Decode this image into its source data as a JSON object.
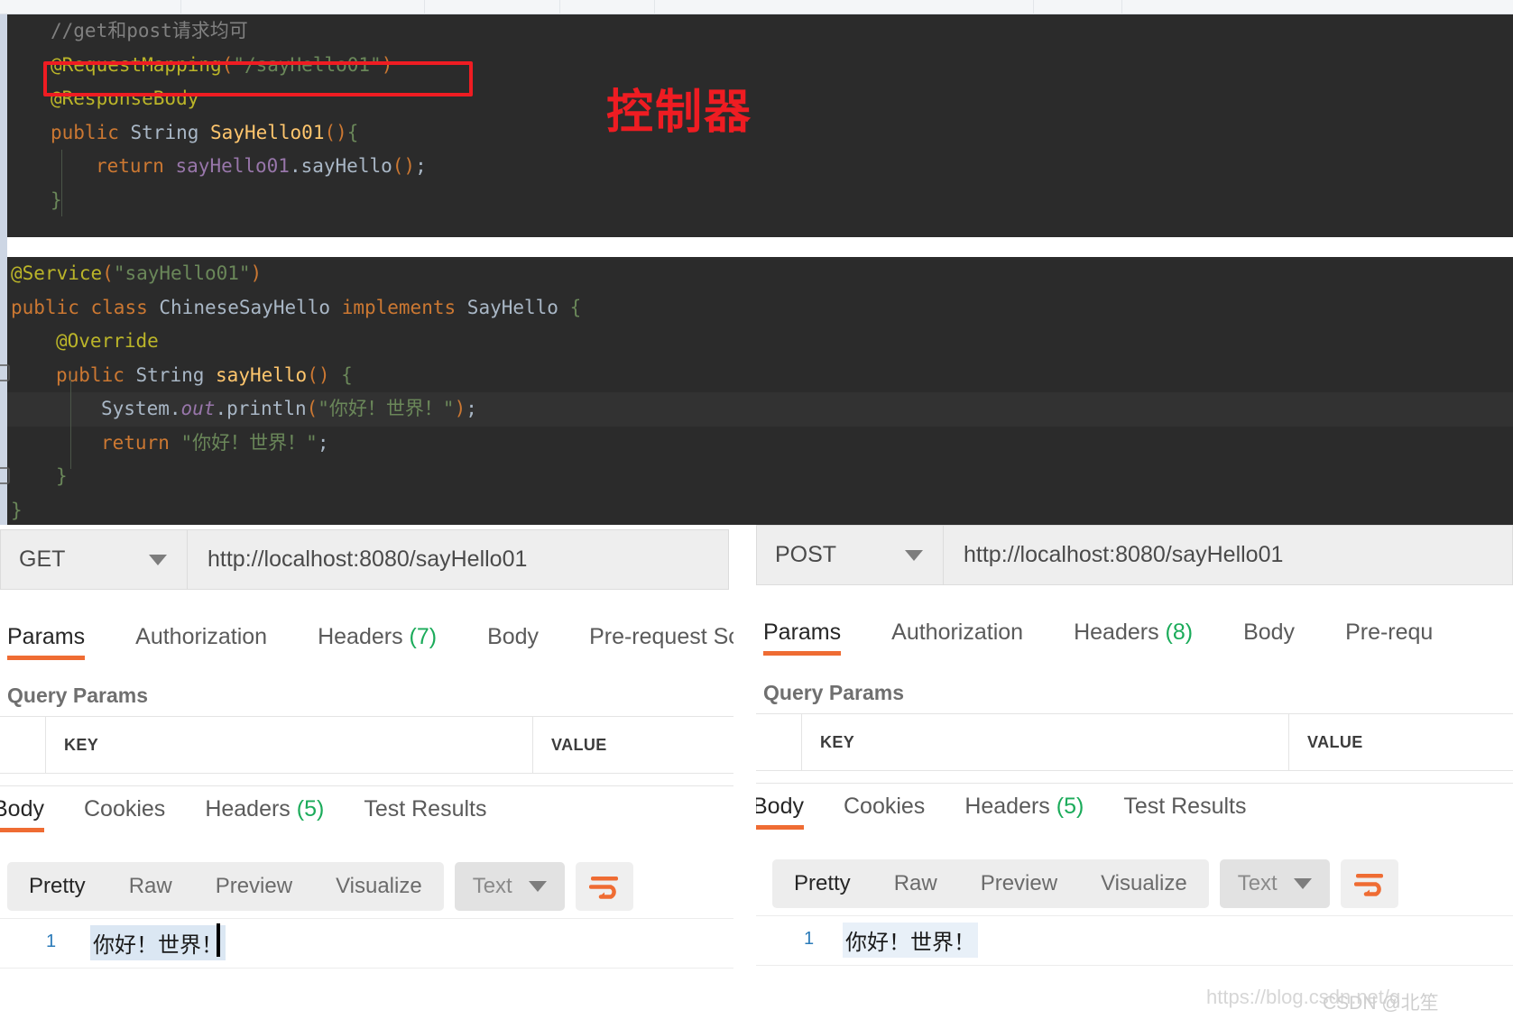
{
  "code_controller": {
    "lines": [
      {
        "indent": 0,
        "tokens": [
          {
            "t": "//get和post请求均可",
            "c": "t-comment"
          }
        ]
      },
      {
        "indent": 0,
        "tokens": [
          {
            "t": "@RequestMapping",
            "c": "t-anno"
          },
          {
            "t": "(",
            "c": "t-paren"
          },
          {
            "t": "\"/sayHello01\"",
            "c": "t-string"
          },
          {
            "t": ")",
            "c": "t-paren"
          }
        ]
      },
      {
        "indent": 0,
        "tokens": [
          {
            "t": "@ResponseBody",
            "c": "t-anno"
          }
        ]
      },
      {
        "indent": 0,
        "tokens": [
          {
            "t": "public",
            "c": "t-kw"
          },
          {
            "t": " ",
            "c": "t-ident"
          },
          {
            "t": "String",
            "c": "t-type"
          },
          {
            "t": " ",
            "c": "t-ident"
          },
          {
            "t": "SayHello01",
            "c": "t-method"
          },
          {
            "t": "()",
            "c": "t-paren"
          },
          {
            "t": "{",
            "c": "t-brace"
          }
        ]
      },
      {
        "indent": 1,
        "tokens": [
          {
            "t": "return",
            "c": "t-kw"
          },
          {
            "t": " ",
            "c": "t-ident"
          },
          {
            "t": "sayHello01",
            "c": "t-field"
          },
          {
            "t": ".",
            "c": "t-ident"
          },
          {
            "t": "sayHello",
            "c": "t-type"
          },
          {
            "t": "()",
            "c": "t-paren"
          },
          {
            "t": ";",
            "c": "t-ident"
          }
        ]
      },
      {
        "indent": 0,
        "tokens": [
          {
            "t": "}",
            "c": "t-brace"
          }
        ]
      }
    ],
    "annotation_label": "控制器"
  },
  "code_service": {
    "lines": [
      {
        "indent": 0,
        "tokens": [
          {
            "t": "@Service",
            "c": "t-anno"
          },
          {
            "t": "(",
            "c": "t-paren"
          },
          {
            "t": "\"sayHello01\"",
            "c": "t-string"
          },
          {
            "t": ")",
            "c": "t-paren"
          }
        ]
      },
      {
        "indent": 0,
        "tokens": [
          {
            "t": "public",
            "c": "t-kw"
          },
          {
            "t": " ",
            "c": "t-ident"
          },
          {
            "t": "class",
            "c": "t-kw"
          },
          {
            "t": " ",
            "c": "t-ident"
          },
          {
            "t": "ChineseSayHello",
            "c": "t-type"
          },
          {
            "t": " ",
            "c": "t-ident"
          },
          {
            "t": "implements",
            "c": "t-kw"
          },
          {
            "t": " ",
            "c": "t-ident"
          },
          {
            "t": "SayHello",
            "c": "t-type"
          },
          {
            "t": " ",
            "c": "t-ident"
          },
          {
            "t": "{",
            "c": "t-brace"
          }
        ]
      },
      {
        "indent": 1,
        "tokens": [
          {
            "t": "@Override",
            "c": "t-anno"
          }
        ]
      },
      {
        "indent": 1,
        "tokens": [
          {
            "t": "public",
            "c": "t-kw"
          },
          {
            "t": " ",
            "c": "t-ident"
          },
          {
            "t": "String",
            "c": "t-type"
          },
          {
            "t": " ",
            "c": "t-ident"
          },
          {
            "t": "sayHello",
            "c": "t-method"
          },
          {
            "t": "()",
            "c": "t-paren"
          },
          {
            "t": " ",
            "c": "t-ident"
          },
          {
            "t": "{",
            "c": "t-brace"
          }
        ]
      },
      {
        "indent": 2,
        "tokens": [
          {
            "t": "System",
            "c": "t-type"
          },
          {
            "t": ".",
            "c": "t-ident"
          },
          {
            "t": "out",
            "c": "t-static"
          },
          {
            "t": ".",
            "c": "t-ident"
          },
          {
            "t": "println",
            "c": "t-type"
          },
          {
            "t": "(",
            "c": "t-paren"
          },
          {
            "t": "\"你好！世界！\"",
            "c": "t-string"
          },
          {
            "t": ")",
            "c": "t-paren"
          },
          {
            "t": ";",
            "c": "t-ident"
          }
        ]
      },
      {
        "indent": 2,
        "tokens": [
          {
            "t": "return",
            "c": "t-kw"
          },
          {
            "t": " ",
            "c": "t-ident"
          },
          {
            "t": "\"你好！世界！\"",
            "c": "t-string"
          },
          {
            "t": ";",
            "c": "t-ident"
          }
        ]
      },
      {
        "indent": 1,
        "tokens": [
          {
            "t": "}",
            "c": "t-brace"
          }
        ]
      },
      {
        "indent": 0,
        "tokens": [
          {
            "t": "}",
            "c": "t-brace"
          }
        ]
      }
    ]
  },
  "postman_left": {
    "method": "GET",
    "url": "http://localhost:8080/sayHello01",
    "request_tabs": [
      {
        "label": "Params",
        "count": "",
        "active": true
      },
      {
        "label": "Authorization",
        "count": "",
        "active": false
      },
      {
        "label": "Headers",
        "count": "(7)",
        "active": false
      },
      {
        "label": "Body",
        "count": "",
        "active": false
      },
      {
        "label": "Pre-request Scrip",
        "count": "",
        "active": false
      }
    ],
    "query_params_title": "Query Params",
    "table_headers": [
      "KEY",
      "VALUE"
    ],
    "response_tabs": [
      {
        "label": "Body",
        "count": "",
        "active": true
      },
      {
        "label": "Cookies",
        "count": "",
        "active": false
      },
      {
        "label": "Headers",
        "count": "(5)",
        "active": false
      },
      {
        "label": "Test Results",
        "count": "",
        "active": false
      }
    ],
    "view_tabs": [
      {
        "label": "Pretty",
        "active": true
      },
      {
        "label": "Raw",
        "active": false
      },
      {
        "label": "Preview",
        "active": false
      },
      {
        "label": "Visualize",
        "active": false
      }
    ],
    "format": "Text",
    "wrap_icon": "word-wrap-icon",
    "body_line_number": "1",
    "body_text": "你好！世界！"
  },
  "postman_right": {
    "method": "POST",
    "url": "http://localhost:8080/sayHello01",
    "request_tabs": [
      {
        "label": "Params",
        "count": "",
        "active": true
      },
      {
        "label": "Authorization",
        "count": "",
        "active": false
      },
      {
        "label": "Headers",
        "count": "(8)",
        "active": false
      },
      {
        "label": "Body",
        "count": "",
        "active": false
      },
      {
        "label": "Pre-requ",
        "count": "",
        "active": false
      }
    ],
    "query_params_title": "Query Params",
    "table_headers": [
      "KEY",
      "VALUE"
    ],
    "response_tabs": [
      {
        "label": "Body",
        "count": "",
        "active": true
      },
      {
        "label": "Cookies",
        "count": "",
        "active": false
      },
      {
        "label": "Headers",
        "count": "(5)",
        "active": false
      },
      {
        "label": "Test Results",
        "count": "",
        "active": false
      }
    ],
    "view_tabs": [
      {
        "label": "Pretty",
        "active": true
      },
      {
        "label": "Raw",
        "active": false
      },
      {
        "label": "Preview",
        "active": false
      },
      {
        "label": "Visualize",
        "active": false
      }
    ],
    "format": "Text",
    "wrap_icon": "word-wrap-icon",
    "body_line_number": "1",
    "body_text": "你好！世界！"
  },
  "watermarks": {
    "url": "https://blog.csdn.net/q",
    "author": "CSDN @北笙"
  },
  "colors": {
    "accent_orange": "#ef6c33",
    "count_green": "#1bab5a",
    "annotation_red": "#ef1c22",
    "editor_bg": "#2b2b2b",
    "gutter_blue": "#cdd6e4"
  }
}
